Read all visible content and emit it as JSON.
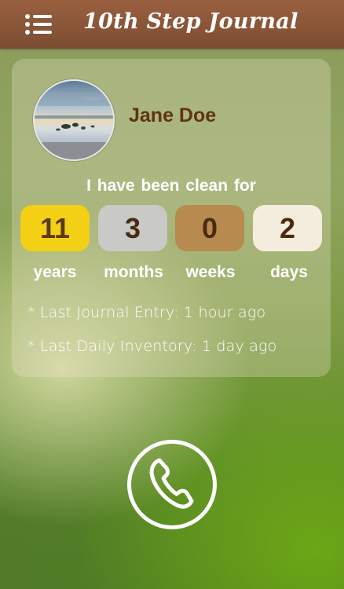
{
  "header": {
    "title": "10th Step Journal",
    "menu_icon": "hamburger-menu-icon",
    "background_color": "#8a5638"
  },
  "profile": {
    "name": "Jane Doe",
    "avatar": "lake-landscape-photo"
  },
  "clean_time": {
    "label": "I have been  clean  for",
    "counters": [
      {
        "unit": "years",
        "value": "11",
        "color": "#f3cf16"
      },
      {
        "unit": "months",
        "value": "3",
        "color": "#c9c9c7"
      },
      {
        "unit": "weeks",
        "value": "0",
        "color": "#b78a4f"
      },
      {
        "unit": "days",
        "value": "2",
        "color": "#f4ecdc"
      }
    ]
  },
  "stats": {
    "last_journal": "* Last Journal Entry:  1 hour ago",
    "last_inventory": "* Last Daily Inventory:  1 day ago"
  },
  "call": {
    "icon": "phone-icon"
  }
}
